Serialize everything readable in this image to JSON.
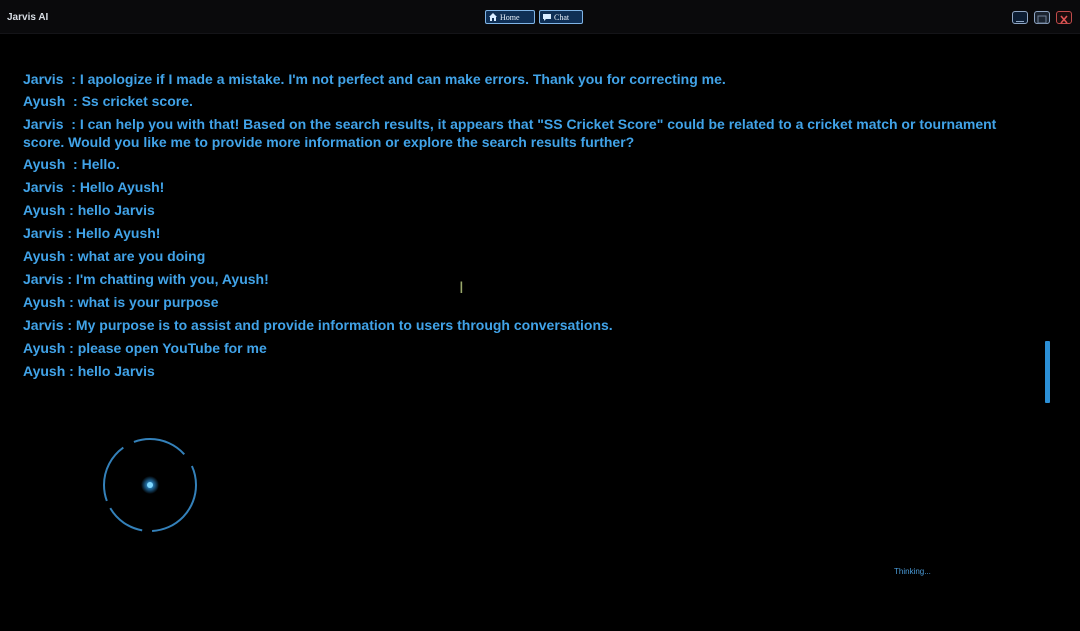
{
  "window": {
    "title": "Jarvis AI",
    "nav": [
      {
        "label": "Home",
        "icon": "home-icon"
      },
      {
        "label": "Chat",
        "icon": "chat-icon"
      }
    ],
    "controls": [
      "minimize-icon",
      "maximize-icon",
      "close-icon"
    ]
  },
  "colors": {
    "text": "#41a3e8",
    "accent": "#2b8fd6",
    "background": "#000000",
    "close": "#c24b4b"
  },
  "chat": {
    "messages": [
      {
        "text": "Jarvis  : I apologize if I made a mistake. I'm not perfect and can make errors. Thank you for correcting me."
      },
      {
        "text": "Ayush  : Ss cricket score."
      },
      {
        "text": "Jarvis  : I can help you with that! Based on the search results, it appears that \"SS Cricket Score\" could be related to a cricket match or tournament score. Would you like me to provide more information or explore the search results further?"
      },
      {
        "text": "Ayush  : Hello."
      },
      {
        "text": "Jarvis  : Hello Ayush!"
      },
      {
        "text": "Ayush : hello Jarvis"
      },
      {
        "text": "Jarvis : Hello Ayush!"
      },
      {
        "text": "Ayush : what are you doing"
      },
      {
        "text": "Jarvis : I'm chatting with you, Ayush!"
      },
      {
        "text": "Ayush : what is your purpose"
      },
      {
        "text": "Jarvis : My purpose is to assist and provide information to users through conversations."
      },
      {
        "text": "Ayush : please open YouTube for me"
      },
      {
        "text": "Ayush : hello Jarvis"
      }
    ]
  },
  "status": {
    "text": "Thinking..."
  }
}
